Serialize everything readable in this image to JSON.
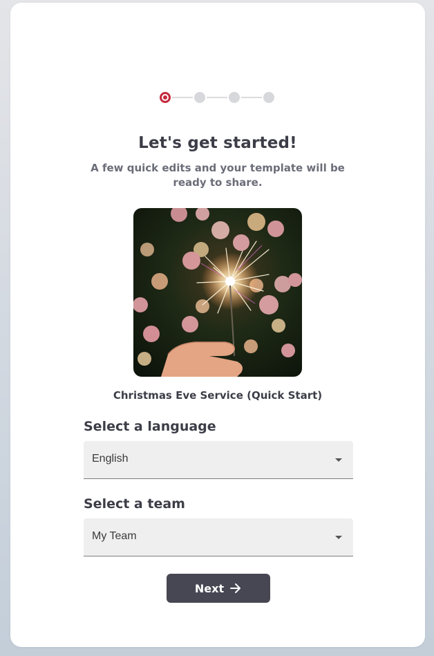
{
  "stepper": {
    "total_steps": 4,
    "current_step": 1,
    "accent": "#c42a3c"
  },
  "header": {
    "title": "Let's get started!",
    "subtitle": "A few quick edits and your template will be ready to share."
  },
  "template": {
    "name": "Christmas Eve Service (Quick Start)"
  },
  "language": {
    "label": "Select a language",
    "selected": "English"
  },
  "team": {
    "label": "Select a team",
    "selected": "My Team"
  },
  "actions": {
    "next_label": "Next",
    "next_icon": "arrow-right-icon"
  },
  "colors": {
    "button_bg": "#474753",
    "text_dark": "#3c3d47",
    "select_bg": "#efefef"
  }
}
